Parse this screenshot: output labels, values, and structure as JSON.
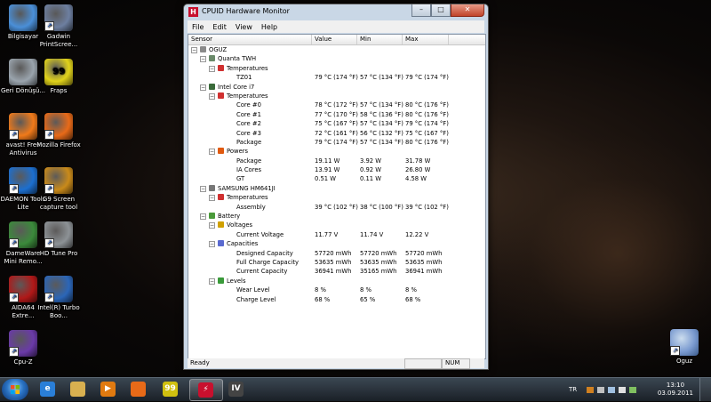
{
  "desktop": {
    "icons_left": [
      {
        "label": "Bilgisayar",
        "icon": "computer-icon",
        "color": "#4a8fd8"
      },
      {
        "label": "Geri Dönüşü...",
        "icon": "recycle-bin-icon",
        "color": "#9aa4ad"
      },
      {
        "label": "avast! Free Antivirus",
        "icon": "avast-icon",
        "color": "#f07a1a"
      },
      {
        "label": "DAEMON Tools Lite",
        "icon": "daemon-tools-icon",
        "color": "#1c6fd0"
      },
      {
        "label": "DameWare Mini Remo...",
        "icon": "dameware-icon",
        "color": "#3b8a3b"
      },
      {
        "label": "AIDA64 Extre...",
        "icon": "aida64-icon",
        "color": "#b01818"
      },
      {
        "label": "Cpu-Z",
        "icon": "cpuz-icon",
        "color": "#6a3aa8"
      }
    ],
    "icons_col2": [
      {
        "label": "Gadwin PrintScree...",
        "icon": "gadwin-icon",
        "color": "#6d7fa0"
      },
      {
        "label": "Fraps",
        "icon": "fraps-icon",
        "color": "#e0d21a",
        "text": "99"
      },
      {
        "label": "Mozilla Firefox",
        "icon": "firefox-icon",
        "color": "#e86a18"
      },
      {
        "label": "G9 Screen capture tool",
        "icon": "g9-capture-icon",
        "color": "#c98a1a"
      },
      {
        "label": "HD Tune Pro",
        "icon": "hdtune-icon",
        "color": "#8d9296"
      },
      {
        "label": "Intel(R) Turbo Boo...",
        "icon": "intel-turbo-icon",
        "color": "#2b66b8"
      }
    ],
    "icon_right": {
      "label": "Oguz",
      "icon": "user-icon",
      "color": "#7a9ad0"
    }
  },
  "window": {
    "title": "CPUID Hardware Monitor",
    "title_icon_text": "H",
    "buttons": {
      "minimize": "–",
      "maximize": "□",
      "close": "✕"
    },
    "menu": [
      "File",
      "Edit",
      "View",
      "Help"
    ],
    "columns": {
      "sensor": "Sensor",
      "value": "Value",
      "min": "Min",
      "max": "Max"
    },
    "status": {
      "left": "Ready",
      "num": "NUM"
    }
  },
  "tree": [
    {
      "depth": 0,
      "expander": "−",
      "icon": "pc-icon",
      "icon_color": "#8a8a8a",
      "label": "OGUZ",
      "value": "",
      "min": "",
      "max": ""
    },
    {
      "depth": 1,
      "expander": "−",
      "icon": "motherboard-icon",
      "icon_color": "#6a8a6a",
      "label": "Quanta TWH",
      "value": "",
      "min": "",
      "max": ""
    },
    {
      "depth": 2,
      "expander": "−",
      "icon": "thermometer-icon",
      "icon_color": "#d03030",
      "label": "Temperatures",
      "value": "",
      "min": "",
      "max": ""
    },
    {
      "depth": 3,
      "expander": "",
      "icon": "",
      "icon_color": "",
      "label": "TZ01",
      "value": "79 °C  (174 °F)",
      "min": "57 °C  (134 °F)",
      "max": "79 °C  (174 °F)"
    },
    {
      "depth": 1,
      "expander": "−",
      "icon": "cpu-chip-icon",
      "icon_color": "#3a6a3a",
      "label": "Intel Core i7",
      "value": "",
      "min": "",
      "max": ""
    },
    {
      "depth": 2,
      "expander": "−",
      "icon": "thermometer-icon",
      "icon_color": "#d03030",
      "label": "Temperatures",
      "value": "",
      "min": "",
      "max": ""
    },
    {
      "depth": 3,
      "expander": "",
      "icon": "",
      "icon_color": "",
      "label": "Core #0",
      "value": "78 °C  (172 °F)",
      "min": "57 °C  (134 °F)",
      "max": "80 °C  (176 °F)"
    },
    {
      "depth": 3,
      "expander": "",
      "icon": "",
      "icon_color": "",
      "label": "Core #1",
      "value": "77 °C  (170 °F)",
      "min": "58 °C  (136 °F)",
      "max": "80 °C  (176 °F)"
    },
    {
      "depth": 3,
      "expander": "",
      "icon": "",
      "icon_color": "",
      "label": "Core #2",
      "value": "75 °C  (167 °F)",
      "min": "57 °C  (134 °F)",
      "max": "79 °C  (174 °F)"
    },
    {
      "depth": 3,
      "expander": "",
      "icon": "",
      "icon_color": "",
      "label": "Core #3",
      "value": "72 °C  (161 °F)",
      "min": "56 °C  (132 °F)",
      "max": "75 °C  (167 °F)"
    },
    {
      "depth": 3,
      "expander": "",
      "icon": "",
      "icon_color": "",
      "label": "Package",
      "value": "79 °C  (174 °F)",
      "min": "57 °C  (134 °F)",
      "max": "80 °C  (176 °F)"
    },
    {
      "depth": 2,
      "expander": "−",
      "icon": "power-icon",
      "icon_color": "#e05a10",
      "label": "Powers",
      "value": "",
      "min": "",
      "max": ""
    },
    {
      "depth": 3,
      "expander": "",
      "icon": "",
      "icon_color": "",
      "label": "Package",
      "value": "19.11 W",
      "min": "3.92 W",
      "max": "31.78 W"
    },
    {
      "depth": 3,
      "expander": "",
      "icon": "",
      "icon_color": "",
      "label": "IA Cores",
      "value": "13.91 W",
      "min": "0.92 W",
      "max": "26.80 W"
    },
    {
      "depth": 3,
      "expander": "",
      "icon": "",
      "icon_color": "",
      "label": "GT",
      "value": "0.51 W",
      "min": "0.11 W",
      "max": "4.58 W"
    },
    {
      "depth": 1,
      "expander": "−",
      "icon": "hard-drive-icon",
      "icon_color": "#777777",
      "label": "SAMSUNG HM641JI",
      "value": "",
      "min": "",
      "max": ""
    },
    {
      "depth": 2,
      "expander": "−",
      "icon": "thermometer-icon",
      "icon_color": "#d03030",
      "label": "Temperatures",
      "value": "",
      "min": "",
      "max": ""
    },
    {
      "depth": 3,
      "expander": "",
      "icon": "",
      "icon_color": "",
      "label": "Assembly",
      "value": "39 °C  (102 °F)",
      "min": "38 °C  (100 °F)",
      "max": "39 °C  (102 °F)"
    },
    {
      "depth": 1,
      "expander": "−",
      "icon": "battery-icon",
      "icon_color": "#4a9a3a",
      "label": "Battery",
      "value": "",
      "min": "",
      "max": ""
    },
    {
      "depth": 2,
      "expander": "−",
      "icon": "voltage-icon",
      "icon_color": "#d0a000",
      "label": "Voltages",
      "value": "",
      "min": "",
      "max": ""
    },
    {
      "depth": 3,
      "expander": "",
      "icon": "",
      "icon_color": "",
      "label": "Current Voltage",
      "value": "11.77 V",
      "min": "11.74 V",
      "max": "12.22 V"
    },
    {
      "depth": 2,
      "expander": "−",
      "icon": "capacity-icon",
      "icon_color": "#5a6ad0",
      "label": "Capacities",
      "value": "",
      "min": "",
      "max": ""
    },
    {
      "depth": 3,
      "expander": "",
      "icon": "",
      "icon_color": "",
      "label": "Designed Capacity",
      "value": "57720 mWh",
      "min": "57720 mWh",
      "max": "57720 mWh"
    },
    {
      "depth": 3,
      "expander": "",
      "icon": "",
      "icon_color": "",
      "label": "Full Charge Capacity",
      "value": "53635 mWh",
      "min": "53635 mWh",
      "max": "53635 mWh"
    },
    {
      "depth": 3,
      "expander": "",
      "icon": "",
      "icon_color": "",
      "label": "Current Capacity",
      "value": "36941 mWh",
      "min": "35165 mWh",
      "max": "36941 mWh"
    },
    {
      "depth": 2,
      "expander": "−",
      "icon": "levels-icon",
      "icon_color": "#3a9a3a",
      "label": "Levels",
      "value": "",
      "min": "",
      "max": ""
    },
    {
      "depth": 3,
      "expander": "",
      "icon": "",
      "icon_color": "",
      "label": "Wear Level",
      "value": "8 %",
      "min": "8 %",
      "max": "8 %"
    },
    {
      "depth": 3,
      "expander": "",
      "icon": "",
      "icon_color": "",
      "label": "Charge Level",
      "value": "68 %",
      "min": "65 %",
      "max": "68 %"
    }
  ],
  "taskbar": {
    "items": [
      {
        "icon": "internet-explorer-icon",
        "color": "#2a7fd8",
        "text": "e",
        "active": false
      },
      {
        "icon": "explorer-folder-icon",
        "color": "#d8b050",
        "text": "",
        "active": false
      },
      {
        "icon": "media-player-icon",
        "color": "#e07a10",
        "text": "▶",
        "active": false
      },
      {
        "icon": "firefox-icon",
        "color": "#e86a18",
        "text": "",
        "active": false
      },
      {
        "icon": "fraps-icon",
        "color": "#d0c010",
        "text": "99",
        "active": false
      },
      {
        "icon": "hwmonitor-icon",
        "color": "#c8102e",
        "text": "⚡",
        "active": true
      },
      {
        "icon": "roman-four-icon",
        "color": "#444444",
        "text": "IV",
        "active": false
      }
    ],
    "tray": {
      "lang": "TR",
      "time": "13:10",
      "date": "03.09.2011"
    }
  }
}
